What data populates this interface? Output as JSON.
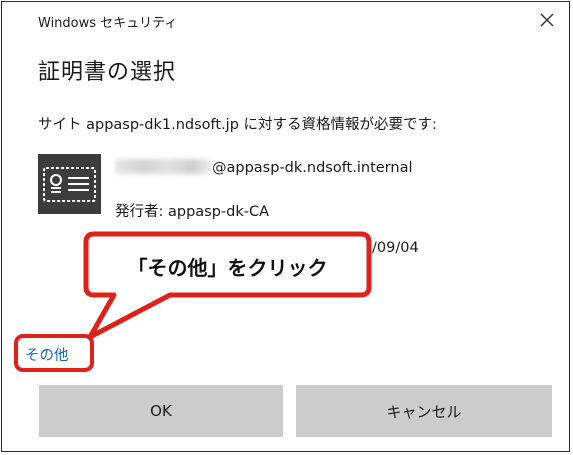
{
  "window": {
    "title": "Windows セキュリティ",
    "close_glyph": "✕"
  },
  "dialog": {
    "heading": "証明書の選択",
    "site_prompt": "サイト appasp-dk1.ndsoft.jp に対する資格情報が必要です:"
  },
  "certificate": {
    "icon": "certificate-icon",
    "account_domain": "@appasp-dk.ndsoft.internal",
    "issuer": "発行者: appasp-dk-CA",
    "validity_fragment": "/09/04"
  },
  "more_choices": {
    "label": "その他"
  },
  "annotation": {
    "callout_text": "「その他」をクリック",
    "highlight_color": "#e0211a"
  },
  "buttons": {
    "ok_label": "OK",
    "cancel_label": "キャンセル",
    "background": "#cccccc"
  },
  "colors": {
    "link": "#1565c0",
    "icon_background": "#3c3c3c"
  }
}
